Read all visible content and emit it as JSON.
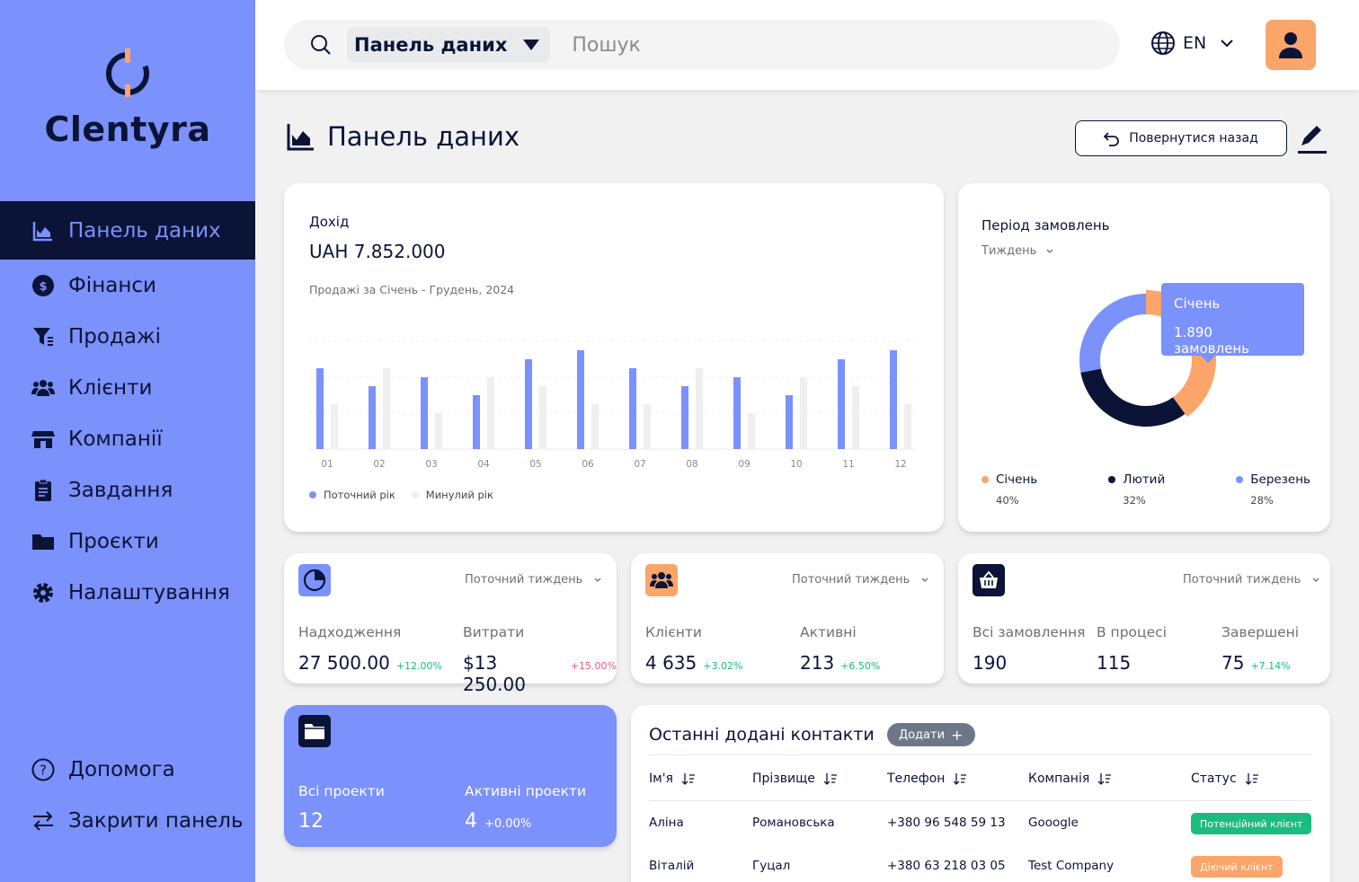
{
  "brand": {
    "name": "Clentyra"
  },
  "colors": {
    "sidebar": "#7b91fb",
    "navy": "#0b1437",
    "orange": "#fba56b",
    "green": "#1cbc7e",
    "red": "#f05a7e",
    "bar_current": "#7b91fb",
    "bar_previous": "#efefef"
  },
  "sidebar": {
    "items": [
      {
        "label": "Панель даних",
        "icon": "chart-area-icon",
        "active": true
      },
      {
        "label": "Фінанси",
        "icon": "dollar-circle-icon"
      },
      {
        "label": "Продажі",
        "icon": "funnel-icon"
      },
      {
        "label": "Клієнти",
        "icon": "users-icon"
      },
      {
        "label": "Компанії",
        "icon": "store-icon"
      },
      {
        "label": "Завдання",
        "icon": "clipboard-icon"
      },
      {
        "label": "Проєкти",
        "icon": "folder-icon"
      },
      {
        "label": "Налаштування",
        "icon": "gear-icon"
      }
    ],
    "bottom": [
      {
        "label": "Допомога",
        "icon": "help-circle-icon"
      },
      {
        "label": "Закрити панель",
        "icon": "swap-arrows-icon"
      }
    ]
  },
  "topbar": {
    "scope": "Панель даних",
    "search_placeholder": "Пошук",
    "language": "EN"
  },
  "page": {
    "title": "Панель даних",
    "back_label": "Повернутися назад"
  },
  "revenue": {
    "label": "Дохід",
    "value": "UAH 7.852.000",
    "subtitle": "Продажі за Січень - Грудень, 2024",
    "legend_current": "Поточний рік",
    "legend_previous": "Минулий рік"
  },
  "chart_data": {
    "type": "bar",
    "categories": [
      "01",
      "02",
      "03",
      "04",
      "05",
      "06",
      "07",
      "08",
      "09",
      "10",
      "11",
      "12"
    ],
    "series": [
      {
        "name": "Поточний рік",
        "values": [
          90,
          70,
          80,
          60,
          100,
          110,
          90,
          70,
          80,
          60,
          100,
          110
        ]
      },
      {
        "name": "Минулий рік",
        "values": [
          50,
          90,
          40,
          80,
          70,
          50,
          50,
          90,
          40,
          80,
          70,
          50
        ]
      }
    ],
    "ylim": [
      0,
      120
    ],
    "grid": true,
    "legend": "bottom-left"
  },
  "orders": {
    "title": "Період замовлень",
    "period": "Тиждень",
    "tooltip_month": "Січень",
    "tooltip_value": "1.890 замовлень",
    "segments": [
      {
        "label": "Січень",
        "percent": "40%",
        "value": 40,
        "color": "#fba56b"
      },
      {
        "label": "Лютий",
        "percent": "32%",
        "value": 32,
        "color": "#0b1437"
      },
      {
        "label": "Березень",
        "percent": "28%",
        "value": 28,
        "color": "#7b91fb"
      }
    ]
  },
  "stats": {
    "finance": {
      "period": "Поточний тиждень",
      "income_label": "Надходження",
      "income_value": "27 500.00",
      "income_change": "+12.00%",
      "expense_label": "Витрати",
      "expense_value": "$13 250.00",
      "expense_change": "+15.00%"
    },
    "clients": {
      "period": "Поточний тиждень",
      "clients_label": "Клієнти",
      "clients_value": "4 635",
      "clients_change": "+3.02%",
      "active_label": "Активні",
      "active_value": "213",
      "active_change": "+6.50%"
    },
    "orders": {
      "period": "Поточний тиждень",
      "all_label": "Всі замовлення",
      "all_value": "190",
      "progress_label": "В процесі",
      "progress_value": "115",
      "done_label": "Завершені",
      "done_value": "75",
      "done_change": "+7.14%"
    }
  },
  "projects": {
    "all_label": "Всі проекти",
    "all_value": "12",
    "active_label": "Активні проекти",
    "active_value": "4",
    "active_change": "+0.00%"
  },
  "contacts": {
    "title": "Останні додані контакти",
    "add_label": "Додати",
    "columns": [
      "Ім'я",
      "Прізвище",
      "Телефон",
      "Компанія",
      "Статус"
    ],
    "rows": [
      {
        "first": "Аліна",
        "last": "Романовська",
        "phone": "+380 96 548 59 13",
        "company": "Gooogle",
        "status": "Потенційний клієнт",
        "status_color": "#1cbc7e"
      },
      {
        "first": "Віталій",
        "last": "Гуцал",
        "phone": "+380 63 218 03 05",
        "company": "Test Company",
        "status": "Діючий клієнт",
        "status_color": "#fba56b"
      }
    ]
  }
}
